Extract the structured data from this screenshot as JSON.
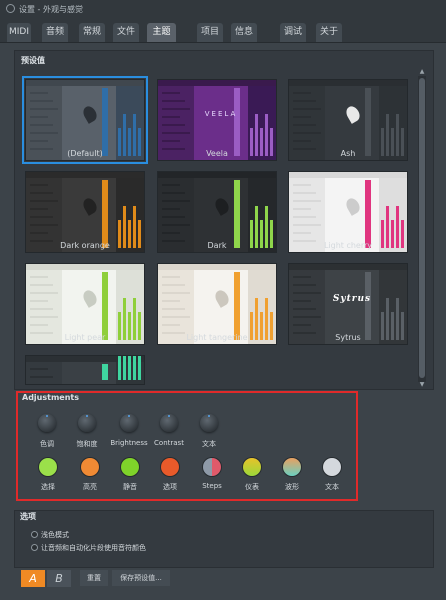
{
  "window": {
    "title": "设置 - 外观与感觉"
  },
  "tabs": [
    {
      "label": "MIDI",
      "active": false
    },
    {
      "label": "音频",
      "active": false
    },
    {
      "label": "常规",
      "active": false
    },
    {
      "label": "文件",
      "active": false
    },
    {
      "label": "主题",
      "active": true
    },
    {
      "label": "项目",
      "active": false
    },
    {
      "label": "信息",
      "active": false
    },
    {
      "label": "调试",
      "active": false
    },
    {
      "label": "关于",
      "active": false
    }
  ],
  "presets": {
    "label": "预设值",
    "selected": "(Default)",
    "items": [
      {
        "name": "(Default)",
        "bg": "#59616a",
        "bar": "#40474e",
        "side": "#4a5158",
        "mix": "#3b4a5a",
        "accent": "#2f6ea8",
        "leaf": "#2b3036"
      },
      {
        "name": "Veela",
        "bg": "#6b2e8a",
        "bar": "#3a1a4d",
        "side": "#4b2263",
        "mix": "#3a1a55",
        "accent": "#9b5dc4",
        "leaf": "#e8d9ff",
        "word": "VEELA"
      },
      {
        "name": "Ash",
        "bg": "#353a3f",
        "bar": "#2a2e32",
        "side": "#303539",
        "mix": "#2d3236",
        "accent": "#4a5056",
        "leaf": "#e8e8e8"
      },
      {
        "name": "Dark orange",
        "bg": "#3a3a3a",
        "bar": "#2b2b2b",
        "side": "#333333",
        "mix": "#2a2a2a",
        "accent": "#e08b1a",
        "leaf": "#222222"
      },
      {
        "name": "Dark",
        "bg": "#2e3134",
        "bar": "#222528",
        "side": "#2a2d30",
        "mix": "#25282b",
        "accent": "#8fd64b",
        "leaf": "#1d1f21"
      },
      {
        "name": "Light cherry",
        "bg": "#f4f4f4",
        "bar": "#d8d8d8",
        "side": "#e6e6e6",
        "mix": "#dedede",
        "accent": "#e0357f",
        "leaf": "#cccccc"
      },
      {
        "name": "Light pear",
        "bg": "#f2f4ef",
        "bar": "#d5d8d0",
        "side": "#e4e7df",
        "mix": "#dde0d8",
        "accent": "#8fcf3a",
        "leaf": "#c8ccc2"
      },
      {
        "name": "Light tangerine",
        "bg": "#f5f3ef",
        "bar": "#dbd6cd",
        "side": "#e9e4db",
        "mix": "#e0dbd2",
        "accent": "#f0a030",
        "leaf": "#ccc7be"
      },
      {
        "name": "Sytrus",
        "bg": "#3e4347",
        "bar": "#2c3033",
        "side": "#363a3e",
        "mix": "#323639",
        "accent": "#5a6066",
        "leaf": "#3e4347",
        "word": "Sytrus"
      },
      {
        "name": "",
        "bg": "#3a4045",
        "bar": "#2b3034",
        "side": "#343a3f",
        "mix": "#2f3539",
        "accent": "#3fd6a0",
        "leaf": "#3a4045"
      }
    ]
  },
  "adjustments": {
    "label": "Adjustments",
    "knobs": [
      {
        "label": "色调"
      },
      {
        "label": "饱和度"
      },
      {
        "label": "Brightness"
      },
      {
        "label": "Contrast"
      },
      {
        "label": "文本"
      }
    ],
    "colors": [
      {
        "label": "选择",
        "color": "#9be04a"
      },
      {
        "label": "高亮",
        "color": "#f08a34"
      },
      {
        "label": "静音",
        "color": "#7fd32a"
      },
      {
        "label": "选项",
        "color": "#e85a2a"
      },
      {
        "label": "Steps",
        "color": "linear-gradient(90deg, #8e9aa8 50%, #e05a6a 50%)"
      },
      {
        "label": "仪表",
        "color": "linear-gradient(180deg, #e8c22a 0%, #9bd83a 100%)"
      },
      {
        "label": "波形",
        "color": "linear-gradient(180deg, #e8a060 0%, #6ad0c0 100%)"
      },
      {
        "label": "文本",
        "color": "#d4d8dd"
      }
    ]
  },
  "options": {
    "label": "选项",
    "items": [
      {
        "label": "浅色模式"
      },
      {
        "label": "让音频和自动化片段使用音符颜色"
      }
    ]
  },
  "footer": {
    "a_label": "A",
    "b_label": "B",
    "reset_label": "重置",
    "save_label": "保存预设值..."
  },
  "colors": {
    "selected_outline": "#2a8ee0",
    "highlight_frame": "#e02a2a",
    "a_active": "#f08a24"
  }
}
